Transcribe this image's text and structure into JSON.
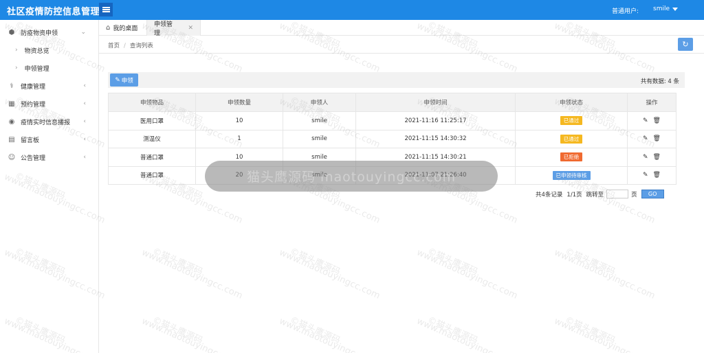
{
  "header": {
    "title": "社区疫情防控信息管理系",
    "user_role": "普通用户:",
    "user_name": "smile"
  },
  "sidebar": {
    "items": [
      {
        "label": "防疫物资申领",
        "icon": "box-icon",
        "expanded": true,
        "children": [
          "物资总览",
          "申领管理"
        ]
      },
      {
        "label": "健康管理",
        "icon": "health-icon"
      },
      {
        "label": "预约管理",
        "icon": "calendar-icon"
      },
      {
        "label": "疫情实时信息播报",
        "icon": "broadcast-icon"
      },
      {
        "label": "留言板",
        "icon": "message-icon"
      },
      {
        "label": "公告管理",
        "icon": "notice-icon"
      }
    ]
  },
  "tabs": [
    {
      "label": "我的桌面",
      "icon": "home-icon"
    },
    {
      "label": "申领管理",
      "active": true,
      "closable": true
    }
  ],
  "breadcrumb": [
    "首页",
    "查询列表"
  ],
  "toolbar": {
    "apply_label": "申领",
    "total_text": "共有数据: 4 条"
  },
  "table": {
    "headers": [
      "申领物品",
      "申领数量",
      "申领人",
      "申领时间",
      "申领状态",
      "操作"
    ],
    "rows": [
      {
        "item": "医用口罩",
        "qty": "10",
        "user": "smile",
        "time": "2021-11:16 11:25:17",
        "status": "已通过",
        "status_color": "#f5b820"
      },
      {
        "item": "测温仪",
        "qty": "1",
        "user": "smile",
        "time": "2021-11:15 14:30:32",
        "status": "已通过",
        "status_color": "#f5b820"
      },
      {
        "item": "普通口罩",
        "qty": "10",
        "user": "smile",
        "time": "2021-11:15 14:30:21",
        "status": "已拒绝",
        "status_color": "#f06a30"
      },
      {
        "item": "普通口罩",
        "qty": "20",
        "user": "smile",
        "time": "2021-11:07 21:26:40",
        "status": "已申领待审核",
        "status_color": "#5c9ee6"
      }
    ]
  },
  "pager": {
    "records": "共4条记录",
    "pages": "1/1页",
    "jump_label": "跳转至",
    "page_unit": "页",
    "page_input_value": "",
    "go_label": "GO"
  },
  "overlay": {
    "text": "猫头鹰源码 maotouyingcc.com"
  },
  "watermark": {
    "line1": "©猫头鹰源码",
    "line2": "www.maotouyingcc.com"
  },
  "colors": {
    "header": "#1e88e5",
    "primary_button": "#5c9ee6",
    "passed": "#f5b820",
    "rejected": "#f06a30",
    "pending": "#5c9ee6"
  }
}
